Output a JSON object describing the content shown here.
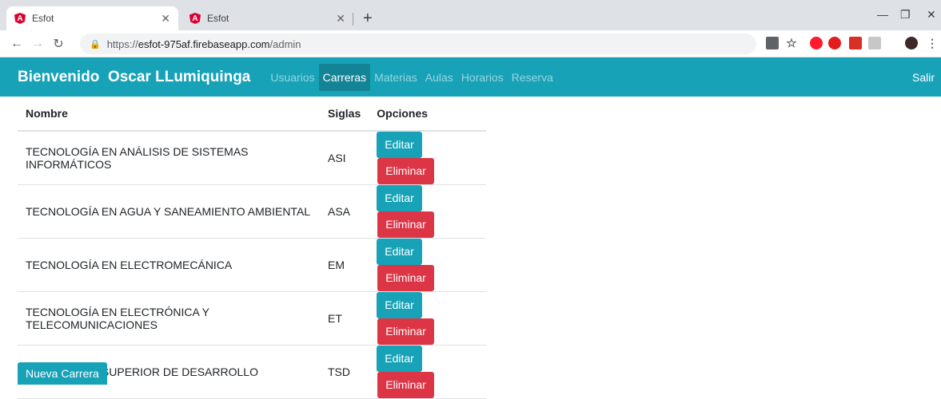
{
  "browser": {
    "tabs": [
      {
        "title": "Esfot",
        "favicon": "A"
      },
      {
        "title": "Esfot",
        "favicon": "A"
      }
    ],
    "url_prefix": "https://",
    "url_host": "esfot-975af.firebaseapp.com",
    "url_path": "/admin"
  },
  "navbar": {
    "brand": "Bienvenido  Oscar LLumiquinga",
    "links": [
      "Usuarios",
      "Carreras",
      "Materias",
      "Aulas",
      "Horarios",
      "Reserva"
    ],
    "active_index": 1,
    "logout": "Salir",
    "color": "#17a2b8"
  },
  "table": {
    "headers": [
      "Nombre",
      "Siglas",
      "Opciones"
    ],
    "rows": [
      {
        "nombre": "TECNOLOGÍA EN ANÁLISIS DE SISTEMAS INFORMÁTICOS",
        "siglas": "ASI"
      },
      {
        "nombre": "TECNOLOGÍA EN AGUA Y SANEAMIENTO AMBIENTAL",
        "siglas": "ASA"
      },
      {
        "nombre": "TECNOLOGÍA EN ELECTROMECÁNICA",
        "siglas": "EM"
      },
      {
        "nombre": "TECNOLOGÍA EN ELECTRÓNICA Y TELECOMUNICACIONES",
        "siglas": "ET"
      },
      {
        "nombre": "TECNOLOGIA SUPERIOR DE DESARROLLO",
        "siglas": "TSD"
      }
    ],
    "edit_label": "Editar",
    "delete_label": "Eliminar"
  },
  "new_button": "Nueva Carrera"
}
